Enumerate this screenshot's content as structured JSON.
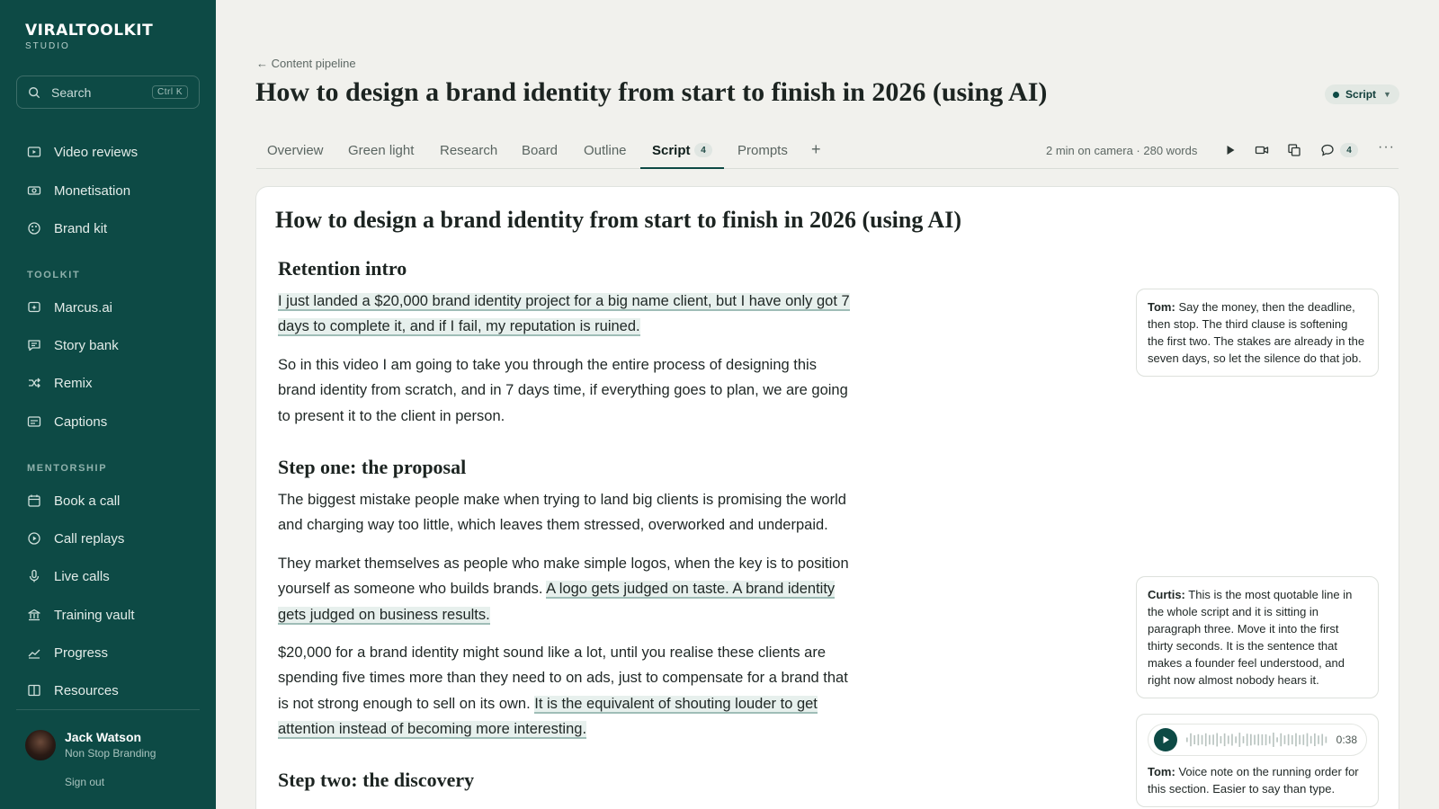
{
  "sidebar": {
    "logo": "VIRALTOOLKIT",
    "logo_sub": "STUDIO",
    "search": {
      "placeholder": "Search",
      "shortcut": "Ctrl K"
    },
    "main_items": [
      "Video reviews",
      "Monetisation",
      "Brand kit"
    ],
    "toolkit_heading": "TOOLKIT",
    "toolkit_items": [
      "Marcus.ai",
      "Story bank",
      "Remix",
      "Captions"
    ],
    "mentorship_heading": "MENTORSHIP",
    "mentorship_items": [
      "Book a call",
      "Call replays",
      "Live calls",
      "Training vault",
      "Progress",
      "Resources"
    ],
    "user": {
      "name": "Jack Watson",
      "org": "Non Stop Branding",
      "sign_out": "Sign out"
    }
  },
  "header": {
    "breadcrumb": "← Content pipeline",
    "title": "How to design a brand identity from start to finish in 2026 (using AI)",
    "status": "Script"
  },
  "tabs": {
    "items": [
      "Overview",
      "Green light",
      "Research",
      "Board",
      "Outline",
      "Script",
      "Prompts"
    ],
    "active": "Script",
    "script_badge": "4",
    "add": "+",
    "meta": "2 min on camera · 280 words",
    "comment_count": "4",
    "more": "···"
  },
  "doc": {
    "title": "How to design a brand identity from start to finish in 2026 (using AI)",
    "sections": {
      "intro_heading": "Retention intro",
      "intro_p1_hl": "I just landed a $20,000 brand identity project for a big name client, but I have only got 7 days to complete it, and if I fail, my reputation is ruined.",
      "intro_p2": "So in this video I am going to take you through the entire process of designing this brand identity from scratch, and in 7 days time, if everything goes to plan, we are going to present it to the client in person.",
      "step1_heading": "Step one: the proposal",
      "step1_p1": "The biggest mistake people make when trying to land big clients is promising the world and charging way too little, which leaves them stressed, overworked and underpaid.",
      "step1_p2_a": "They market themselves as people who make simple logos, when the key is to position yourself as someone who builds brands. ",
      "step1_p2_hl": "A logo gets judged on taste. A brand identity gets judged on business results.",
      "step1_p3_a": "$20,000 for a brand identity might sound like a lot, until you realise these clients are spending five times more than they need to on ads, just to compensate for a brand that is not strong enough to sell on its own. ",
      "step1_p3_hl": "It is the equivalent of shouting louder to get attention instead of becoming more interesting.",
      "step2_heading": "Step two: the discovery"
    }
  },
  "comments": [
    {
      "author": "Tom:",
      "text": "Say the money, then the deadline, then stop. The third clause is softening the first two. The stakes are already in the seven days, so let the silence do that job."
    },
    {
      "author": "Curtis:",
      "text": "This is the most quotable line in the whole script and it is sitting in paragraph three. Move it into the first thirty seconds. It is the sentence that makes a founder feel understood, and right now almost nobody hears it."
    },
    {
      "author": "Tom:",
      "text": "Voice note on the running order for this section. Easier to say than type.",
      "duration": "0:38"
    }
  ]
}
